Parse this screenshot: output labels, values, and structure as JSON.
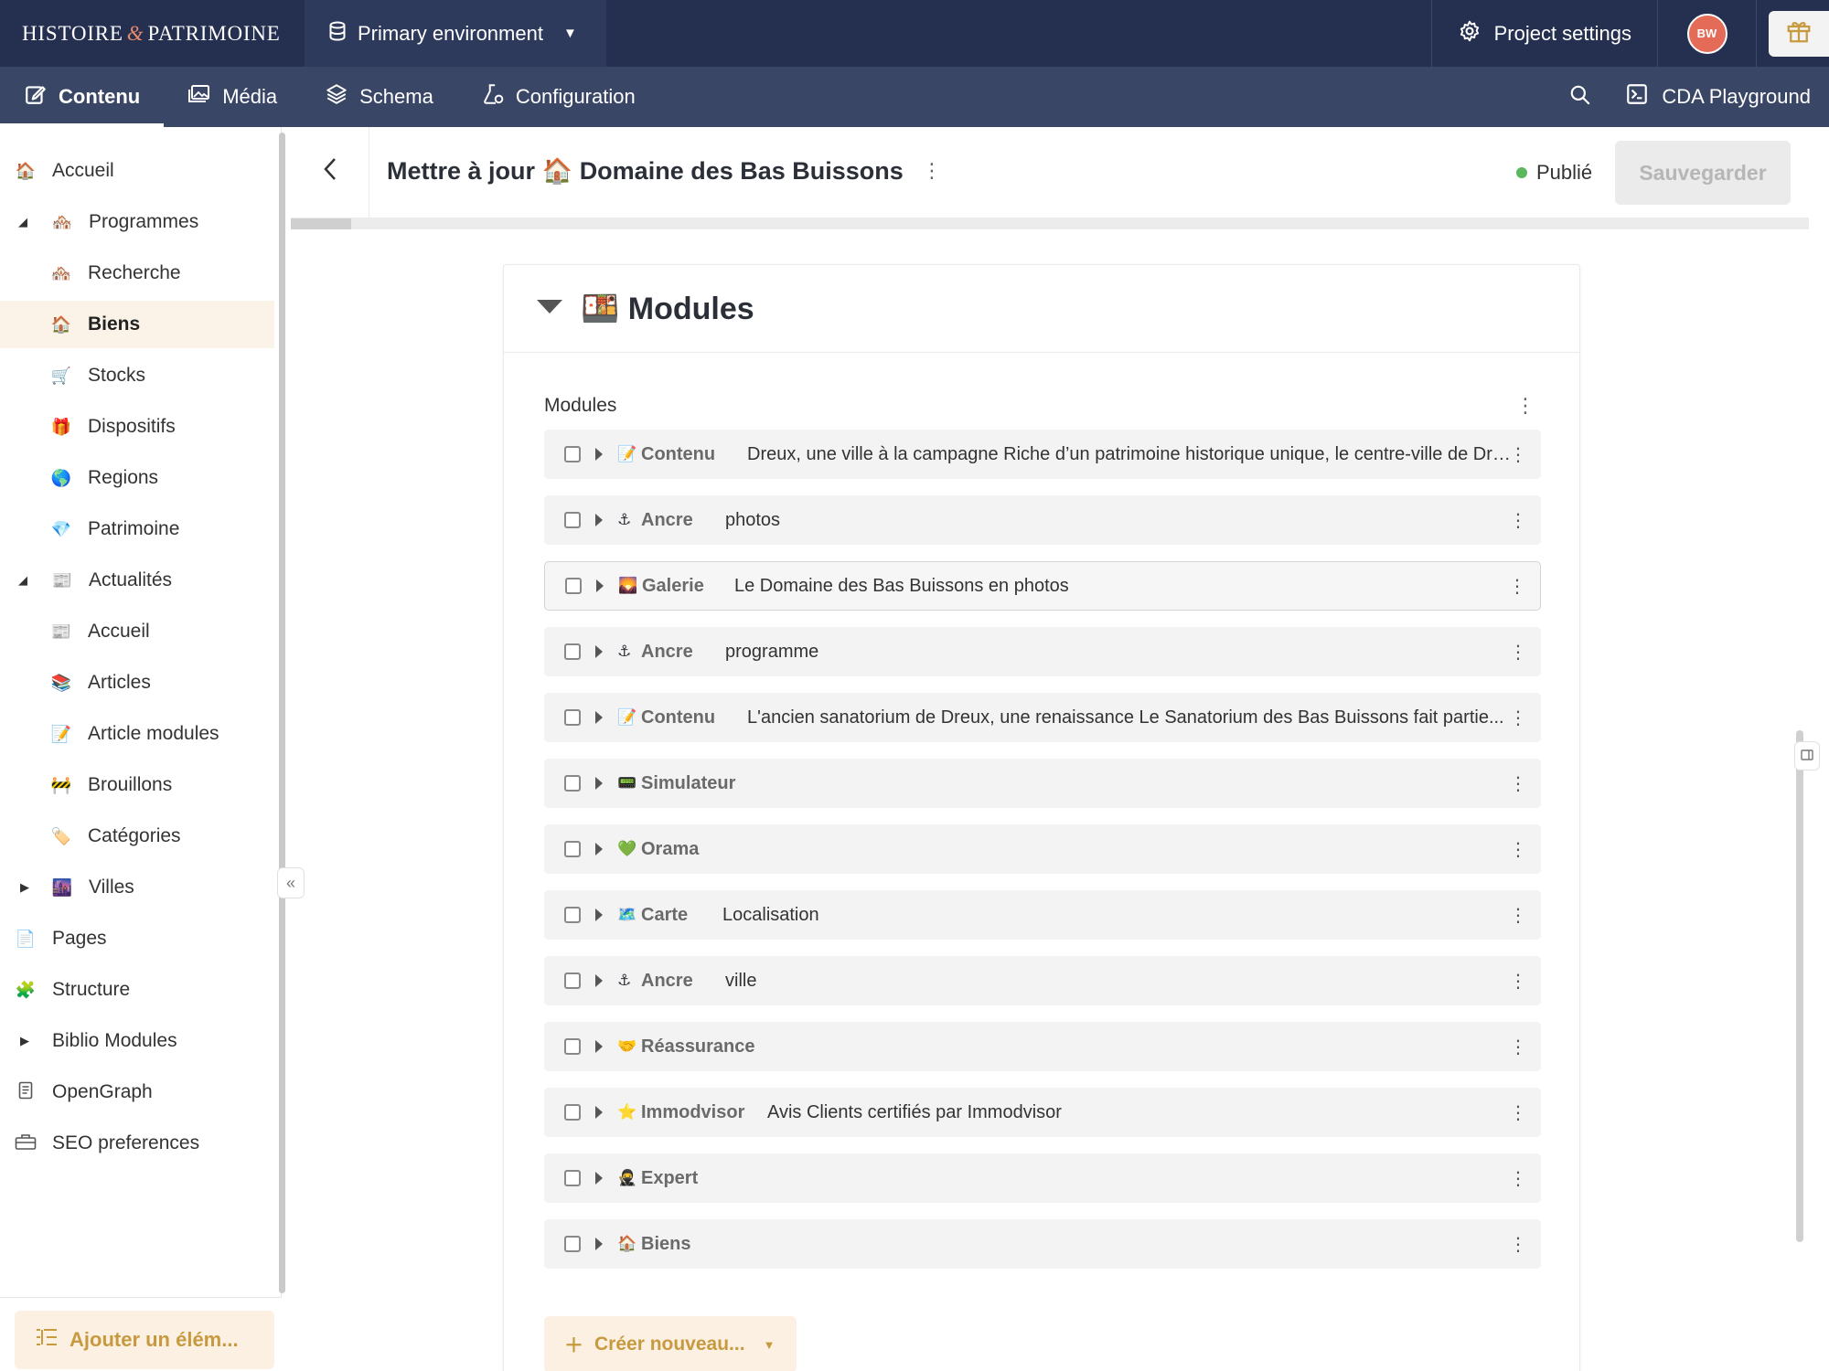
{
  "topbar": {
    "logo_part1": "HISTOIRE",
    "logo_amp": "&",
    "logo_part2": "PATRIMOINE",
    "environment": "Primary environment",
    "project_settings": "Project settings",
    "avatar_initials": "BW"
  },
  "nav": {
    "tabs": [
      {
        "label": "Contenu",
        "icon": "edit-icon",
        "active": true
      },
      {
        "label": "Média",
        "icon": "image-icon"
      },
      {
        "label": "Schema",
        "icon": "layers-icon"
      },
      {
        "label": "Configuration",
        "icon": "flask-icon"
      }
    ],
    "cda_playground": "CDA Playground"
  },
  "sidebar": {
    "items": [
      {
        "label": "Accueil",
        "emoji": "🏠"
      },
      {
        "label": "Programmes",
        "emoji": "🏘️",
        "expanded": true
      },
      {
        "label": "Recherche",
        "emoji": "🏘️"
      },
      {
        "label": "Biens",
        "emoji": "🏠",
        "active": true
      },
      {
        "label": "Stocks",
        "emoji": "🛒"
      },
      {
        "label": "Dispositifs",
        "emoji": "🎁"
      },
      {
        "label": "Regions",
        "emoji": "🌎"
      },
      {
        "label": "Patrimoine",
        "emoji": "💎"
      },
      {
        "label": "Actualités",
        "emoji": "📰",
        "expanded": true
      },
      {
        "label": "Accueil",
        "emoji": "📰"
      },
      {
        "label": "Articles",
        "emoji": "📚"
      },
      {
        "label": "Article modules",
        "emoji": "📝"
      },
      {
        "label": "Brouillons",
        "emoji": "🚧"
      },
      {
        "label": "Catégories",
        "emoji": "🏷️"
      },
      {
        "label": "Villes",
        "emoji": "🌆",
        "expanded": false
      },
      {
        "label": "Pages",
        "emoji": "📄"
      },
      {
        "label": "Structure",
        "emoji": "🧩"
      },
      {
        "label": "Biblio Modules",
        "emoji": "",
        "expanded": false
      },
      {
        "label": "OpenGraph",
        "emoji": "📄"
      },
      {
        "label": "SEO preferences",
        "emoji": "🧰"
      }
    ],
    "add_button": "Ajouter un élém..."
  },
  "main": {
    "title_prefix": "Mettre à jour",
    "title_emoji": "🏠",
    "title_name": "Domaine des Bas Buissons",
    "status": "Publié",
    "status_color": "#5cb85c",
    "save_button": "Sauvegarder",
    "progress": 0.04
  },
  "modules_card": {
    "title_emoji": "🍱",
    "title": "Modules",
    "field_label": "Modules",
    "rows": [
      {
        "emoji": "📝",
        "type": "Contenu",
        "preview": "Dreux, une ville à la campagne Riche d’un patrimoine historique unique, le centre-ville de Dreux..."
      },
      {
        "emoji": "⚓",
        "type": "Ancre",
        "preview": "photos"
      },
      {
        "emoji": "🌄",
        "type": "Galerie",
        "preview": "Le Domaine des Bas Buissons en photos"
      },
      {
        "emoji": "⚓",
        "type": "Ancre",
        "preview": "programme"
      },
      {
        "emoji": "📝",
        "type": "Contenu",
        "preview": "L'ancien sanatorium de Dreux, une renaissance Le Sanatorium des Bas Buissons fait partie..."
      },
      {
        "emoji": "📟",
        "type": "Simulateur",
        "preview": ""
      },
      {
        "emoji": "💚",
        "type": "Orama",
        "preview": ""
      },
      {
        "emoji": "🗺️",
        "type": "Carte",
        "preview": "Localisation"
      },
      {
        "emoji": "⚓",
        "type": "Ancre",
        "preview": "ville"
      },
      {
        "emoji": "🤝",
        "type": "Réassurance",
        "preview": ""
      },
      {
        "emoji": "⭐",
        "type": "Immodvisor",
        "preview": "Avis Clients certifiés par Immodvisor"
      },
      {
        "emoji": "🥷",
        "type": "Expert",
        "preview": ""
      },
      {
        "emoji": "🏠",
        "type": "Biens",
        "preview": ""
      }
    ],
    "create_button": "Créer nouveau..."
  },
  "colors": {
    "topbar": "#253050",
    "navbar": "#3a4666",
    "accent": "#c89a40",
    "active_bg": "#fcf3e8"
  }
}
